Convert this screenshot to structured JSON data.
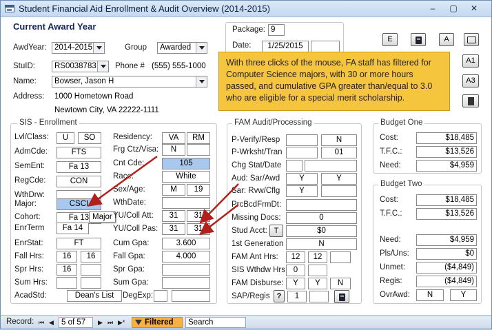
{
  "window": {
    "title": "Student Financial Aid Enrollment & Audit Overview (2014-2015)",
    "controls": {
      "minimize": "‒",
      "restore": "▢",
      "close": "✕"
    }
  },
  "header": {
    "heading": "Current Award Year",
    "awdyear": {
      "label": "AwdYear:",
      "value": "2014-2015"
    },
    "group": {
      "label": "Group",
      "value": "Awarded"
    },
    "stuid": {
      "label": "StuID:",
      "value": "RS0038783"
    },
    "phone": {
      "label": "Phone #",
      "value": "(555) 555-1000"
    },
    "name": {
      "label": "Name:",
      "value": "Bowser, Jason H"
    },
    "address": {
      "label": "Address:",
      "line1": "1000 Hometown Road",
      "line2": "Newtown City, VA  22222-1111"
    },
    "package": {
      "label": "Package:",
      "value": "9"
    },
    "date": {
      "label": "Date:",
      "value": "1/25/2015",
      "extra": ""
    }
  },
  "toolbar": {
    "e_label": "E",
    "a_label": "A",
    "a1_label": "A1",
    "a3_label": "A3"
  },
  "callout": {
    "text": "With three clicks of the mouse, FA staff has filtered for Computer Science majors, with 30 or more hours passed, and cumulative GPA greater than/equal to 3.0 who are eligible for a special merit scholarship."
  },
  "tooltip": {
    "text": "Major"
  },
  "sis": {
    "title": "SIS - Enrollment",
    "lvl": {
      "label": "Lvl/Class:",
      "v1": "U",
      "v2": "SO"
    },
    "admcde": {
      "label": "AdmCde:",
      "value": "FTS"
    },
    "sement": {
      "label": "SemEnt:",
      "value": "Fa 13"
    },
    "regcde": {
      "label": "RegCde:",
      "value": "CON"
    },
    "wthdrw": {
      "label": "WthDrw:",
      "value": ""
    },
    "major": {
      "label": "Major:",
      "value": "CSCI"
    },
    "cohort": {
      "label": "Cohort:",
      "value": "Fa 13"
    },
    "enrterm": {
      "label": "EnrTerm",
      "value": "Fa 14"
    },
    "enrstat": {
      "label": "EnrStat:",
      "value": "FT"
    },
    "fallhrs": {
      "label": "Fall Hrs:",
      "v1": "16",
      "v2": "16"
    },
    "sprhrs": {
      "label": "Spr Hrs:",
      "v1": "16",
      "v2": ""
    },
    "sumhrs": {
      "label": "Sum Hrs:",
      "v1": "",
      "v2": ""
    },
    "acadstd": {
      "label": "AcadStd:",
      "value": "Dean's List"
    },
    "residency": {
      "label": "Residency:",
      "v1": "VA",
      "v2": "RM"
    },
    "frgctz": {
      "label": "Frg Ctz/Visa:",
      "v1": "N",
      "v2": ""
    },
    "cntcde": {
      "label": "Cnt Cde:",
      "value": "105"
    },
    "race": {
      "label": "Race:",
      "value": "White"
    },
    "sexage": {
      "label": "Sex/Age:",
      "v1": "M",
      "v2": "19"
    },
    "wthdate": {
      "label": "WthDate:",
      "value": ""
    },
    "yucollatt": {
      "label": "YU/Coll Att:",
      "v1": "31",
      "v2": "31"
    },
    "yucollpas": {
      "label": "YU/Coll Pas:",
      "v1": "31",
      "v2": "31"
    },
    "cumgpa": {
      "label": "Cum Gpa:",
      "value": "3.600"
    },
    "fallgpa": {
      "label": "Fall Gpa:",
      "value": "4.000"
    },
    "sprgpa": {
      "label": "Spr Gpa:",
      "value": ""
    },
    "sumgpa": {
      "label": "Sum Gpa:",
      "value": ""
    },
    "degexp": {
      "label": "DegExp:",
      "v1": "",
      "v2": ""
    }
  },
  "fam": {
    "title": "FAM Audit/Processing",
    "pverify": {
      "label": "P-Verify/Resp",
      "v1": "",
      "v2": "N"
    },
    "pwrksht": {
      "label": "P-Wrksht/Tran",
      "v1": "",
      "v2": "01"
    },
    "chgstat": {
      "label": "Chg Stat/Date",
      "v1": "",
      "v2": ""
    },
    "audsar": {
      "label": "Aud: Sar/Awd",
      "v1": "Y",
      "v2": "Y"
    },
    "sarrvw": {
      "label": "Sar: Rvw/Cflg",
      "v1": "Y",
      "v2": ""
    },
    "prcbcd": {
      "label": "PrcBcdFrmDt:",
      "value": ""
    },
    "missing": {
      "label": "Missing Docs:",
      "value": "0"
    },
    "studacct": {
      "label": "Stud Acct:",
      "btn": "T",
      "value": "$0"
    },
    "firstgen": {
      "label": "1st Generation",
      "value": "N"
    },
    "famant": {
      "label": "FAM Ant Hrs:",
      "v1": "12",
      "v2": "12",
      "v3": ""
    },
    "siswthdw": {
      "label": "SIS Wthdw Hrs:",
      "v1": "0",
      "v2": ""
    },
    "famdisburse": {
      "label": "FAM Disburse:",
      "v1": "Y",
      "v2": "Y",
      "v3": "N"
    },
    "sapregis": {
      "label": "SAP/Regis",
      "v1": "1",
      "v2": ""
    }
  },
  "budget_one": {
    "title": "Budget One",
    "cost": {
      "label": "Cost:",
      "value": "$18,485"
    },
    "tfc": {
      "label": "T.F.C.:",
      "value": "$13,526"
    },
    "need": {
      "label": "Need:",
      "value": "$4,959"
    }
  },
  "budget_two": {
    "title": "Budget Two",
    "cost": {
      "label": "Cost:",
      "value": "$18,485"
    },
    "tfc": {
      "label": "T.F.C.:",
      "value": "$13,526"
    },
    "need": {
      "label": "Need:",
      "value": "$4,959"
    },
    "plsuns": {
      "label": "Pls/Uns:",
      "value": "$0"
    },
    "unmet": {
      "label": "Unmet:",
      "value": "($4,849)"
    },
    "regis": {
      "label": "Regis:",
      "value": "($4,849)"
    },
    "ovrawd": {
      "label": "OvrAwd:",
      "v1": "N",
      "v2": "Y"
    }
  },
  "statusbar": {
    "record_label": "Record:",
    "record_value": "5 of 57",
    "first": "⏮",
    "prev": "◀",
    "next": "▶",
    "last": "⏭",
    "new": "▶*",
    "filtered": "Filtered",
    "search": "Search"
  },
  "colors": {
    "callout": "#f6c53e",
    "filtered": "#f6b142",
    "highlight": "#a8c8f0",
    "arrow": "#b3201c"
  }
}
